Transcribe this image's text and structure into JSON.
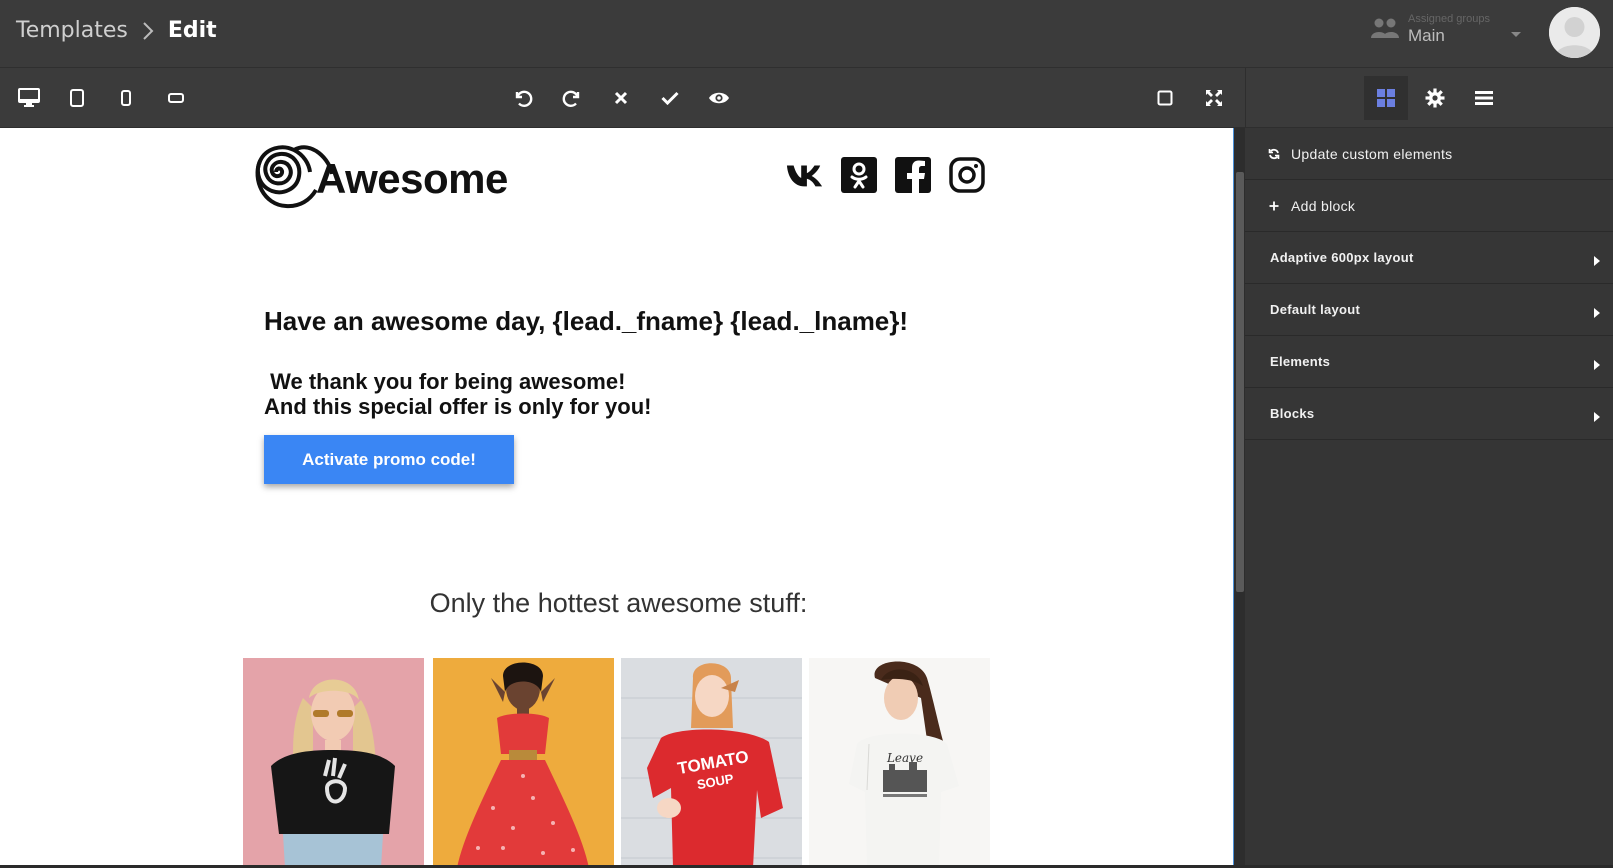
{
  "header": {
    "breadcrumb": {
      "parent": "Templates",
      "current": "Edit"
    },
    "assigned_groups": {
      "caption": "Assigned groups",
      "value": "Main"
    },
    "icons": {
      "chevron": "chevron-right-icon",
      "groups": "users-icon",
      "caret": "caret-down-icon",
      "avatar": "user-avatar"
    }
  },
  "toolbar": {
    "left": [
      {
        "name": "desktop-view-icon"
      },
      {
        "name": "tablet-view-icon"
      },
      {
        "name": "mobile-view-icon"
      },
      {
        "name": "mobile-landscape-view-icon"
      }
    ],
    "center": [
      {
        "name": "undo-icon"
      },
      {
        "name": "redo-icon"
      },
      {
        "name": "cancel-icon"
      },
      {
        "name": "save-check-icon"
      },
      {
        "name": "preview-eye-icon"
      }
    ],
    "right": [
      {
        "name": "outline-toggle-icon"
      },
      {
        "name": "fullscreen-icon"
      }
    ]
  },
  "panel_tabs": [
    {
      "name": "blocks-grid-icon",
      "active": true
    },
    {
      "name": "settings-gear-icon",
      "active": false
    },
    {
      "name": "layers-menu-icon",
      "active": false
    }
  ],
  "email": {
    "logo_text": "Awesome",
    "social_icons": [
      "vk-icon",
      "odnoklassniki-icon",
      "facebook-icon",
      "instagram-icon"
    ],
    "greeting": "Have an awesome day, {lead._fname} {lead._lname}!",
    "thanks_line1": " We thank you for being awesome!",
    "thanks_line2": "And this special offer is only for you!",
    "promo_button": "Activate promo code!",
    "hottest": "Only the hottest awesome stuff:"
  },
  "panel": {
    "actions": [
      {
        "label": "Update custom elements",
        "icon": "refresh-icon"
      },
      {
        "label": "Add block",
        "icon": "plus-icon"
      }
    ],
    "sections": [
      {
        "label": "Adaptive 600px layout"
      },
      {
        "label": "Default layout"
      },
      {
        "label": "Elements"
      },
      {
        "label": "Blocks"
      }
    ]
  },
  "colors": {
    "accent": "#3a86f4",
    "dark": "#3b3b3b",
    "panel": "#353535",
    "active_tab_icon": "#6b7fe0"
  }
}
